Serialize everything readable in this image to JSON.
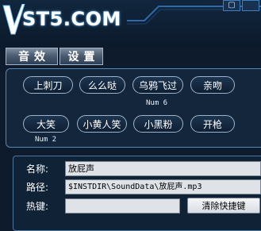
{
  "app": {
    "logo_text": "ST5.COM",
    "logo_mark": "v-logo-mark"
  },
  "window": {
    "restore_icon": "restore-icon",
    "restore_glyph": "▢"
  },
  "tabs": [
    {
      "label": "音效"
    },
    {
      "label": "设置"
    }
  ],
  "sounds": [
    {
      "label": "上刺刀"
    },
    {
      "label": "么么哒"
    },
    {
      "label": "乌鸦飞过",
      "hint": "Num 6"
    },
    {
      "label": "亲吻"
    },
    {
      "label": "大笑",
      "hint": "Num 2"
    },
    {
      "label": "小黄人笑"
    },
    {
      "label": "小黑粉"
    },
    {
      "label": "开枪"
    }
  ],
  "detail": {
    "name_label": "名称:",
    "name_value": "放屁声",
    "path_label": "路径:",
    "path_value": "$INSTDIR\\SoundData\\放屁声.mp3",
    "hotkey_label": "热键:",
    "hotkey_value": "",
    "clear_button": "清除快捷键"
  },
  "colors": {
    "background": "#0d1b2c",
    "panel_border": "#5a86b3",
    "accent_glow": "#5fb8ff"
  }
}
